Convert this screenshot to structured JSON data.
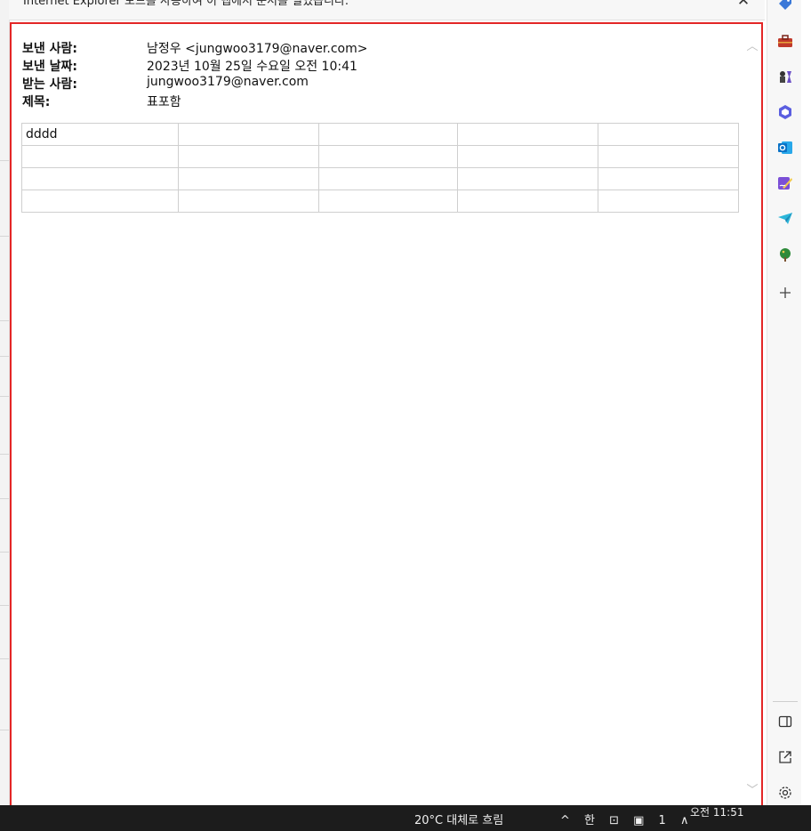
{
  "info_bar": {
    "text": "Internet Explorer 모드를 사용하여 이 탭에서 문서를 열었습니다.",
    "close_icon": "close-icon"
  },
  "email": {
    "from_label": "보낸 사람:",
    "from_value": "남정우 <jungwoo3179@naver.com>",
    "sent_label": "보낸 날짜:",
    "sent_value": "2023년 10월 25일 수요일 오전 10:41",
    "to_label": "받는 사람:",
    "to_value": "jungwoo3179@naver.com",
    "subject_label": "제목:",
    "subject_value": "표포함"
  },
  "table": {
    "rows": [
      [
        "dddd",
        "",
        "",
        "",
        ""
      ],
      [
        "",
        "",
        "",
        "",
        ""
      ],
      [
        "",
        "",
        "",
        "",
        ""
      ],
      [
        "",
        "",
        "",
        "",
        ""
      ]
    ]
  },
  "sidebar": {
    "icons": [
      "tag-icon",
      "toolbox-icon",
      "chess-icon",
      "microsoft365-icon",
      "outlook-icon",
      "designer-icon",
      "send-icon",
      "tree-icon",
      "add-icon"
    ],
    "bottom_icons": [
      "split-screen-icon",
      "open-external-icon",
      "settings-icon"
    ],
    "accent_colors": {
      "tag": "#3a78d8",
      "toolbox": "#c0392b",
      "outlook": "#0a72c6",
      "tree": "#2e8b3a"
    }
  },
  "taskbar": {
    "weather": "20°C 대체로 흐림",
    "tray": "^ 한 ⊡ ▣ 1 ∧",
    "time": "오전 11:51"
  },
  "colors": {
    "frame_border": "#e32626",
    "grid_border": "#cfcfcf"
  }
}
